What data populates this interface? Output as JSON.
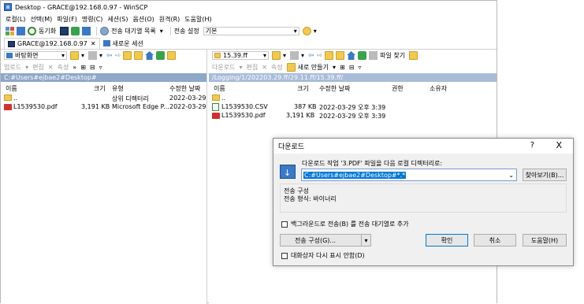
{
  "window": {
    "title": "Desktop - GRACE@192.168.0.97 - WinSCP"
  },
  "menu": [
    "로컬(L)",
    "선택(M)",
    "파일(F)",
    "명령(C)",
    "세션(S)",
    "옵션(O)",
    "원격(R)",
    "도움말(H)"
  ],
  "toolbar": {
    "sync_label": "동기화",
    "queue_label": "전송 대기열 목록",
    "transfer_settings_label": "전송 설정",
    "transfer_settings_value": "기본"
  },
  "tabs": {
    "session": "GRACE@192.168.0.97",
    "new_session": "새로운 세션"
  },
  "left": {
    "location": "바탕화면",
    "upload": "업로드",
    "edit": "편집",
    "props": "속성",
    "path": "C:#Users#ejbae2#Desktop#",
    "headers": {
      "name": "이름",
      "size": "크기",
      "type": "유형",
      "modified": "수정한 날짜"
    },
    "rows": [
      {
        "name": "..",
        "size": "",
        "type": "상위 디렉터리",
        "modified": "2022-03-29"
      },
      {
        "name": "L1539530.pdf",
        "size": "3,191 KB",
        "type": "Microsoft Edge P...",
        "modified": "2022-03-29"
      }
    ]
  },
  "right": {
    "location": "15.39.ff",
    "find": "파일 찾기",
    "download": "다운로드",
    "edit": "편집",
    "props": "속성",
    "new": "새로 만들기",
    "path": "/Logging/1/202203.29.ff/29.11.ff/15.39.ff/",
    "headers": {
      "name": "이름",
      "size": "크기",
      "modified": "수정한 날짜",
      "rights": "권한",
      "owner": "소유자"
    },
    "rows": [
      {
        "name": "..",
        "size": "",
        "modified": "",
        "icon": "up"
      },
      {
        "name": "L1539530.CSV",
        "size": "387 KB",
        "modified": "2022-03-29 오후 3:39",
        "icon": "csv"
      },
      {
        "name": "L1539530.pdf",
        "size": "3,191 KB",
        "modified": "2022-03-29 오후 3:39",
        "icon": "pdf"
      }
    ]
  },
  "dialog": {
    "title": "다운로드",
    "help_char": "?",
    "close_char": "X",
    "prompt": "다운로드 작업 '3.PDF' 파일을 다음 로컬 디렉터리로:",
    "target": "C:#Users#ejbae2#Desktop#*.*",
    "browse": "찾아보기(B)...",
    "group_title": "전송 구성",
    "group_text": "전송 형식: 바이너리",
    "background_label": "백그라운드로 전송(B) 를 전송 대기열로 추가",
    "settings_btn": "전송 구성(G)...",
    "ok": "확인",
    "cancel": "취소",
    "help": "도움말(H)",
    "no_show_label": "대화상자 다시 표시 안함(D)"
  }
}
